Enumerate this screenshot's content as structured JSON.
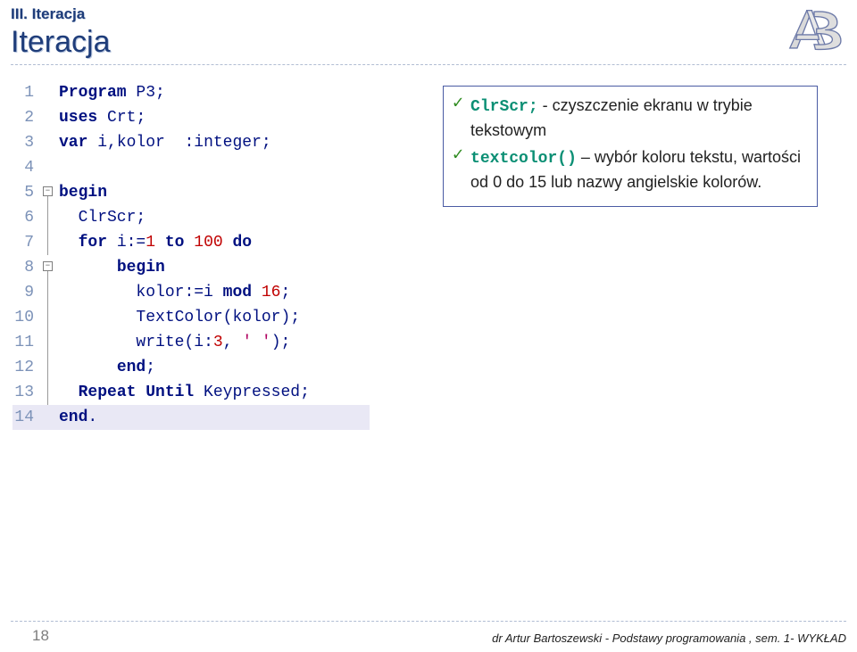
{
  "header": {
    "breadcrumb": "III. Iteracja",
    "title": "Iteracja"
  },
  "code": {
    "lines": [
      {
        "n": "1",
        "fold": "",
        "tokens": [
          [
            "kw",
            "Program"
          ],
          [
            "ident",
            " P3"
          ],
          [
            "ident",
            ";"
          ]
        ]
      },
      {
        "n": "2",
        "fold": "",
        "tokens": [
          [
            "kw",
            "uses"
          ],
          [
            "ident",
            " Crt"
          ],
          [
            "ident",
            ";"
          ]
        ]
      },
      {
        "n": "3",
        "fold": "",
        "tokens": [
          [
            "kw",
            "var"
          ],
          [
            "ident",
            " i"
          ],
          [
            "ident",
            ","
          ],
          [
            "ident",
            "kolor  "
          ],
          [
            "ident",
            ":"
          ],
          [
            "typ",
            "integer"
          ],
          [
            "ident",
            ";"
          ]
        ]
      },
      {
        "n": "4",
        "fold": "",
        "tokens": []
      },
      {
        "n": "5",
        "fold": "minus",
        "tokens": [
          [
            "kw",
            "begin"
          ]
        ]
      },
      {
        "n": "6",
        "fold": "line",
        "tokens": [
          [
            "ident",
            "  ClrScr"
          ],
          [
            "ident",
            ";"
          ]
        ]
      },
      {
        "n": "7",
        "fold": "line",
        "tokens": [
          [
            "ident",
            "  "
          ],
          [
            "kw",
            "for"
          ],
          [
            "ident",
            " i"
          ],
          [
            "ident",
            ":="
          ],
          [
            "num",
            "1"
          ],
          [
            "ident",
            " "
          ],
          [
            "kw",
            "to"
          ],
          [
            "ident",
            " "
          ],
          [
            "num",
            "100"
          ],
          [
            "ident",
            " "
          ],
          [
            "kw",
            "do"
          ]
        ]
      },
      {
        "n": "8",
        "fold": "minus2",
        "tokens": [
          [
            "ident",
            "      "
          ],
          [
            "kw",
            "begin"
          ]
        ]
      },
      {
        "n": "9",
        "fold": "line2",
        "tokens": [
          [
            "ident",
            "        kolor"
          ],
          [
            "ident",
            ":="
          ],
          [
            "ident",
            "i "
          ],
          [
            "kw",
            "mod"
          ],
          [
            "ident",
            " "
          ],
          [
            "num",
            "16"
          ],
          [
            "ident",
            ";"
          ]
        ]
      },
      {
        "n": "10",
        "fold": "line2",
        "tokens": [
          [
            "ident",
            "        TextColor"
          ],
          [
            "ident",
            "("
          ],
          [
            "ident",
            "kolor"
          ],
          [
            "ident",
            ")"
          ],
          [
            "ident",
            ";"
          ]
        ]
      },
      {
        "n": "11",
        "fold": "line2",
        "tokens": [
          [
            "ident",
            "        write"
          ],
          [
            "ident",
            "("
          ],
          [
            "ident",
            "i"
          ],
          [
            "ident",
            ":"
          ],
          [
            "num",
            "3"
          ],
          [
            "ident",
            ","
          ],
          [
            "ident",
            " "
          ],
          [
            "str",
            "' '"
          ],
          [
            "ident",
            ")"
          ],
          [
            "ident",
            ";"
          ]
        ]
      },
      {
        "n": "12",
        "fold": "line",
        "tokens": [
          [
            "ident",
            "      "
          ],
          [
            "kw",
            "end"
          ],
          [
            "ident",
            ";"
          ]
        ]
      },
      {
        "n": "13",
        "fold": "line",
        "tokens": [
          [
            "ident",
            "  "
          ],
          [
            "kw",
            "Repeat Until"
          ],
          [
            "ident",
            " Keypressed"
          ],
          [
            "ident",
            ";"
          ]
        ]
      },
      {
        "n": "14",
        "fold": "",
        "tokens": [
          [
            "kw",
            "end"
          ],
          [
            "ident",
            "."
          ]
        ],
        "hl": true
      }
    ]
  },
  "info": {
    "items": [
      {
        "cmd": "ClrScr;",
        "text": " - czyszczenie ekranu w trybie tekstowym"
      },
      {
        "cmd": "textcolor()",
        "text": " – wybór koloru tekstu, wartości od 0 do 15 lub nazwy angielskie kolorów."
      }
    ]
  },
  "footer": {
    "page": "18",
    "credit": "dr Artur Bartoszewski  - Podstawy programowania , sem. 1- WYKŁAD"
  }
}
